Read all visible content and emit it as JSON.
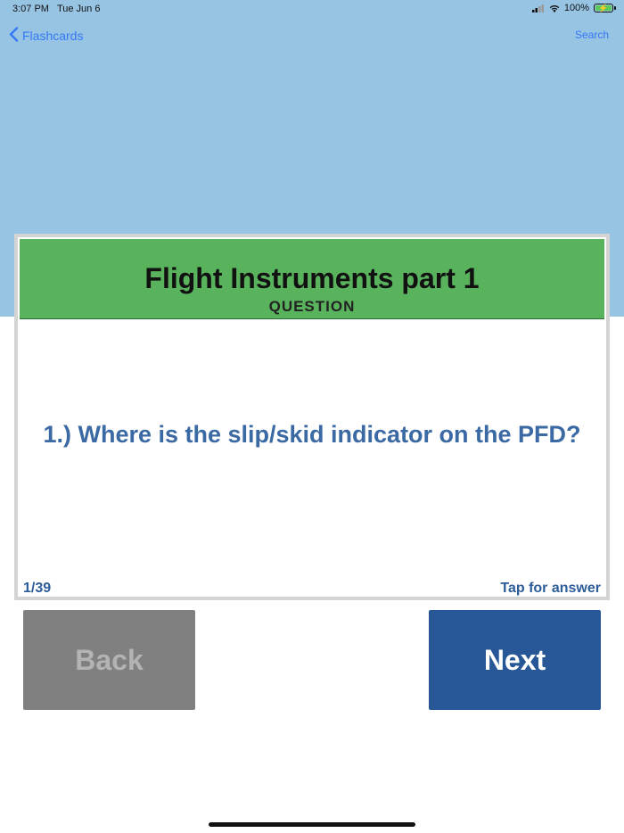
{
  "status_bar": {
    "time": "3:07 PM",
    "date": "Tue Jun 6",
    "battery": "100%",
    "icons": [
      "signal-icon",
      "wifi-icon",
      "battery-charging-icon"
    ]
  },
  "nav": {
    "back_label": "Flashcards",
    "search_label": "Search"
  },
  "card": {
    "title": "Flight Instruments part 1",
    "subtitle": "QUESTION",
    "question": "1.) Where is the slip/skid indicator on the PFD?",
    "counter": "1/39",
    "tap_hint": "Tap for answer"
  },
  "buttons": {
    "back_label": "Back",
    "next_label": "Next",
    "back_enabled": false
  },
  "colors": {
    "top_background": "#98c4e4",
    "header_green": "#59b35c",
    "question_text": "#3a69a3",
    "next_button": "#285797",
    "back_button_disabled": "#808080",
    "link_blue": "#3478f6"
  }
}
